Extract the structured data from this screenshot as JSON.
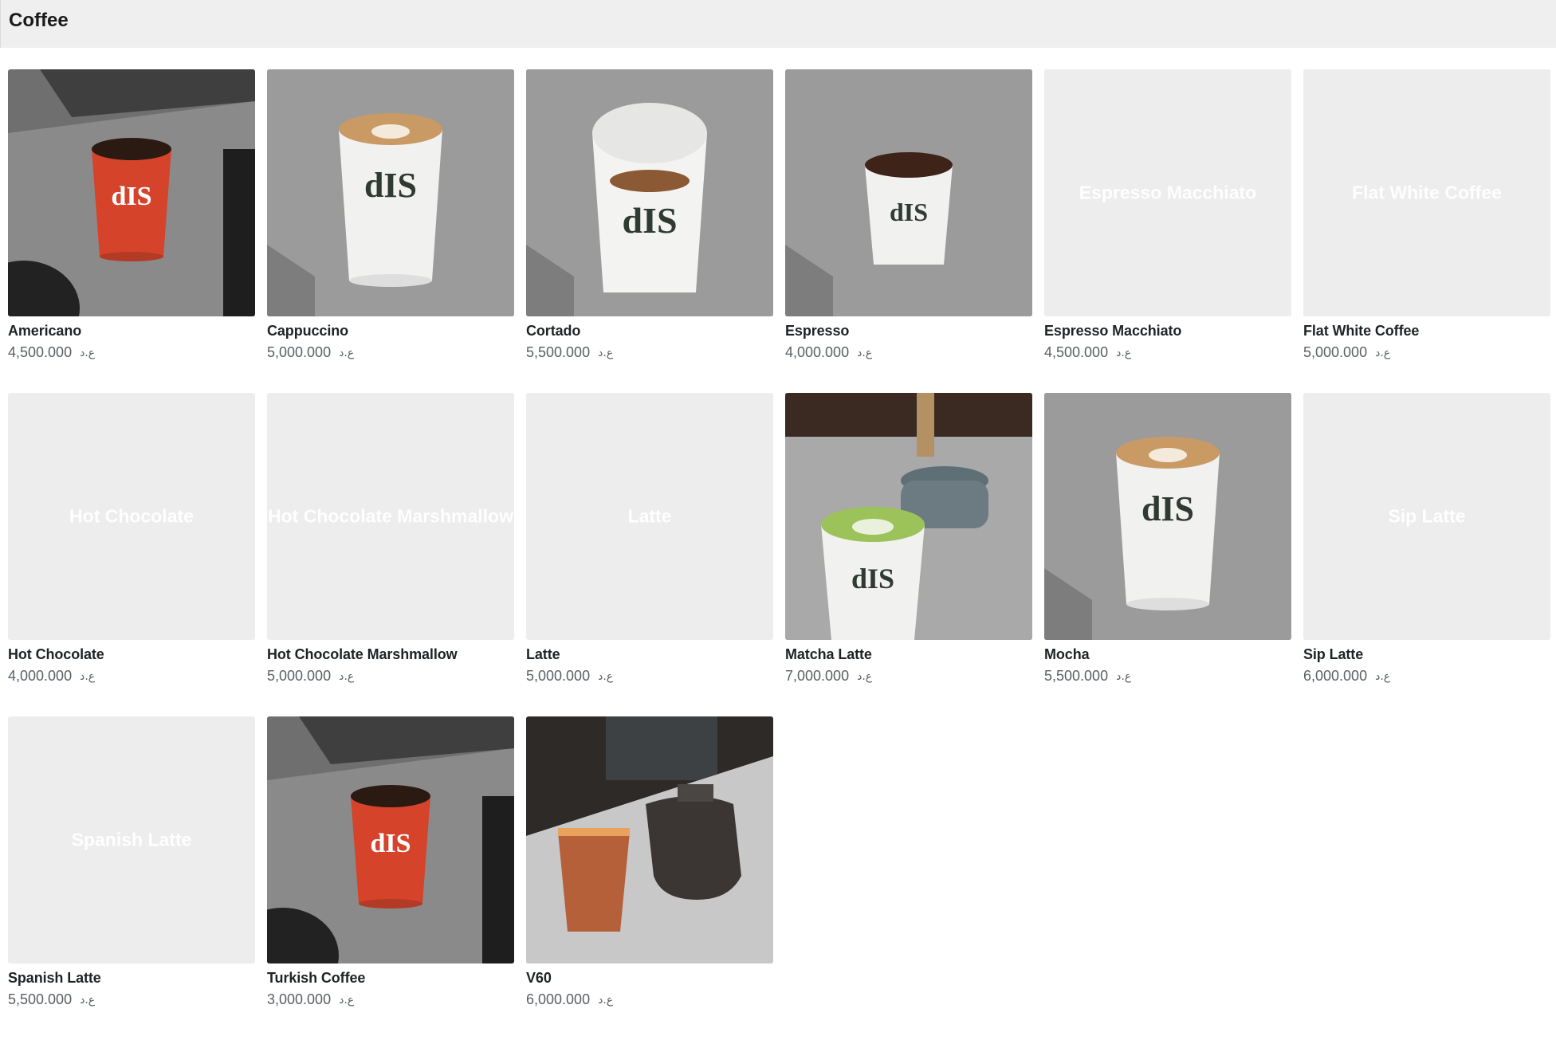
{
  "header": {
    "title": "Coffee"
  },
  "currency_symbol": "ع.د",
  "products": [
    {
      "name": "Americano",
      "price": "4,500.000",
      "image": "photo",
      "cup": "red",
      "scene": "machine"
    },
    {
      "name": "Cappuccino",
      "price": "5,000.000",
      "image": "photo",
      "cup": "white-foam",
      "scene": "counter"
    },
    {
      "name": "Cortado",
      "price": "5,500.000",
      "image": "photo",
      "cup": "white-open",
      "scene": "granite"
    },
    {
      "name": "Espresso",
      "price": "4,000.000",
      "image": "photo",
      "cup": "white-small",
      "scene": "counter"
    },
    {
      "name": "Espresso Macchiato",
      "price": "4,500.000",
      "image": "placeholder",
      "placeholder_label": "Espresso Macchiato"
    },
    {
      "name": "Flat White Coffee",
      "price": "5,000.000",
      "image": "placeholder",
      "placeholder_label": "Flat White Coffee"
    },
    {
      "name": "Hot Chocolate",
      "price": "4,000.000",
      "image": "placeholder",
      "placeholder_label": "Hot Chocolate"
    },
    {
      "name": "Hot Chocolate Marshmallow",
      "price": "5,000.000",
      "image": "placeholder",
      "placeholder_label": "Hot Chocolate Marshmallow"
    },
    {
      "name": "Latte",
      "price": "5,000.000",
      "image": "placeholder",
      "placeholder_label": "Latte"
    },
    {
      "name": "Matcha Latte",
      "price": "7,000.000",
      "image": "photo",
      "cup": "matcha",
      "scene": "matcha"
    },
    {
      "name": "Mocha",
      "price": "5,500.000",
      "image": "photo",
      "cup": "white-foam",
      "scene": "counter"
    },
    {
      "name": "Sip Latte",
      "price": "6,000.000",
      "image": "placeholder",
      "placeholder_label": "Sip Latte"
    },
    {
      "name": "Spanish Latte",
      "price": "5,500.000",
      "image": "placeholder",
      "placeholder_label": "Spanish Latte"
    },
    {
      "name": "Turkish Coffee",
      "price": "3,000.000",
      "image": "photo",
      "cup": "red",
      "scene": "machine"
    },
    {
      "name": "V60",
      "price": "6,000.000",
      "image": "photo",
      "cup": "iced",
      "scene": "v60"
    }
  ]
}
